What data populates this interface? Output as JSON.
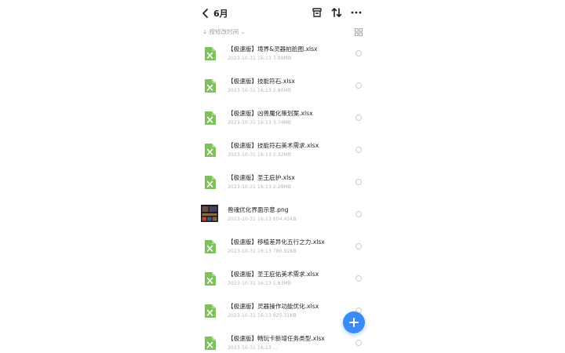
{
  "header": {
    "title": "6月"
  },
  "sort": {
    "label": "按修改时间"
  },
  "files": [
    {
      "name": "【极速版】境界&灵器拍脸图.xlsx",
      "meta": "2023-10-31  16:13  3.98MB",
      "type": "xlsx"
    },
    {
      "name": "【极速版】技能符石.xlsx",
      "meta": "2023-10-31  16:13  2.86MB",
      "type": "xlsx"
    },
    {
      "name": "【极速版】凶兽魔化策划案.xlsx",
      "meta": "2023-10-31  16:13  3.74MB",
      "type": "xlsx"
    },
    {
      "name": "【极速版】技能符石美术需求.xlsx",
      "meta": "2023-10-31  16:13  2.32MB",
      "type": "xlsx"
    },
    {
      "name": "【极速版】圣王庇护.xlsx",
      "meta": "2023-10-31  16:13  2.28MB",
      "type": "xlsx"
    },
    {
      "name": "兽魂优化界面示意.png",
      "meta": "2023-10-31  16:13  604.45KB",
      "type": "png"
    },
    {
      "name": "【极速版】移植差异化五行之力.xlsx",
      "meta": "2023-10-31  16:13  780.92KB",
      "type": "xlsx"
    },
    {
      "name": "【极速版】圣王庇佑美术需求.xlsx",
      "meta": "2023-10-31  16:13  1.83MB",
      "type": "xlsx"
    },
    {
      "name": "【极速版】灵器操作功能优化.xlsx",
      "meta": "2023-10-31  16:13  925.31KB",
      "type": "xlsx"
    },
    {
      "name": "【极速版】畅玩卡新增任务类型.xlsx",
      "meta": "2023-10-31  16:13  ...",
      "type": "xlsx"
    }
  ],
  "colors": {
    "accent": "#3a8bf5",
    "excel": "#7dc15a"
  }
}
